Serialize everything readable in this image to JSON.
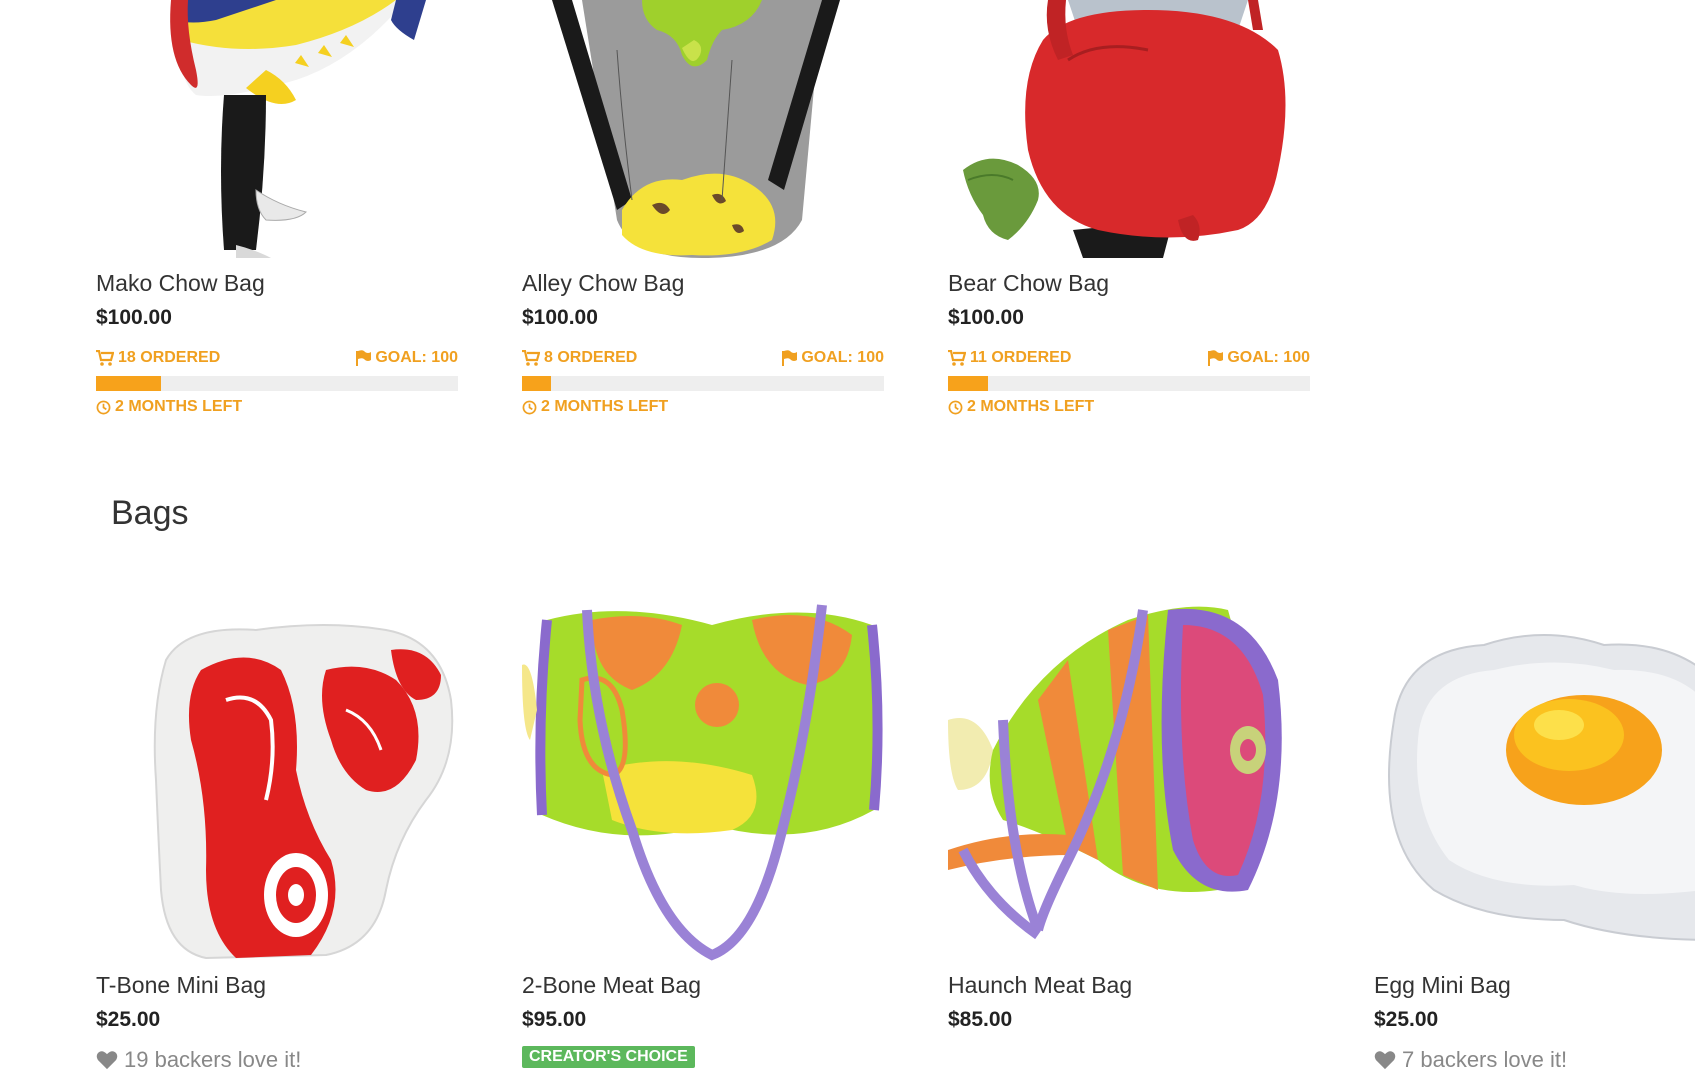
{
  "colors": {
    "accent": "#f7a21b",
    "badge": "#5cb85c",
    "muted": "#888888"
  },
  "crowdfund_products": [
    {
      "name": "Mako Chow Bag",
      "price": "$100.00",
      "ordered": "18 ORDERED",
      "goal": "GOAL: 100",
      "progress_fraction": 0.18,
      "time_left": "2 MONTHS LEFT"
    },
    {
      "name": "Alley Chow Bag",
      "price": "$100.00",
      "ordered": "8 ORDERED",
      "goal": "GOAL: 100",
      "progress_fraction": 0.08,
      "time_left": "2 MONTHS LEFT"
    },
    {
      "name": "Bear Chow Bag",
      "price": "$100.00",
      "ordered": "11 ORDERED",
      "goal": "GOAL: 100",
      "progress_fraction": 0.11,
      "time_left": "2 MONTHS LEFT"
    }
  ],
  "section": {
    "title": "Bags"
  },
  "bag_products": [
    {
      "name": "T-Bone Mini Bag",
      "price": "$25.00",
      "backers": "19 backers love it!"
    },
    {
      "name": "2-Bone Meat Bag",
      "price": "$95.00",
      "badge": "CREATOR'S CHOICE"
    },
    {
      "name": "Haunch Meat Bag",
      "price": "$85.00"
    },
    {
      "name": "Egg Mini Bag",
      "price": "$25.00",
      "backers": "7 backers love it!"
    }
  ],
  "icons": {
    "cart": "cart-icon",
    "flag": "flag-icon",
    "clock": "clock-icon",
    "heart": "heart-icon"
  }
}
